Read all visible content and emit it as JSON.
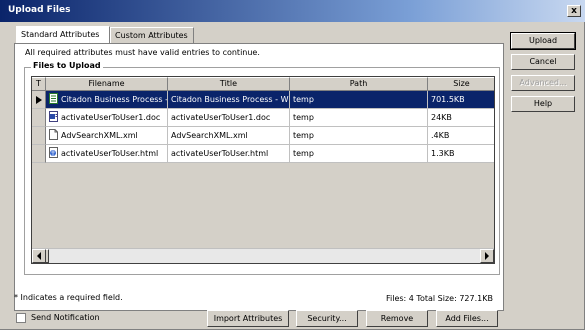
{
  "window": {
    "title": "Upload Files",
    "close_label": "x"
  },
  "tabs": [
    {
      "label": "Standard Attributes"
    },
    {
      "label": "Custom Attributes"
    }
  ],
  "required_message": "All required attributes must have valid entries to continue.",
  "files_group_label": "Files to Upload",
  "columns": [
    "T",
    "Filename",
    "Title",
    "Path",
    "Size"
  ],
  "files": [
    {
      "icon": "spreadsheet-icon",
      "filename": "Citadon Business Process - W",
      "title": "Citadon Business Process - W",
      "path": "temp",
      "size": "701.5KB",
      "selected": true
    },
    {
      "icon": "word-doc-icon",
      "filename": "activateUserToUser1.doc",
      "title": "activateUserToUser1.doc",
      "path": "temp",
      "size": "24KB",
      "selected": false
    },
    {
      "icon": "xml-file-icon",
      "filename": "AdvSearchXML.xml",
      "title": "AdvSearchXML.xml",
      "path": "temp",
      "size": ".4KB",
      "selected": false
    },
    {
      "icon": "html-file-icon",
      "filename": "activateUserToUser.html",
      "title": "activateUserToUser.html",
      "path": "temp",
      "size": "1.3KB",
      "selected": false
    }
  ],
  "side_buttons": {
    "upload": "Upload",
    "cancel": "Cancel",
    "advanced": "Advanced...",
    "help": "Help"
  },
  "footer": {
    "required_note": "* Indicates a required field.",
    "stats": "Files: 4 Total Size: 727.1KB",
    "send_notification": "Send Notification",
    "send_notification_checked": false
  },
  "bottom_buttons": {
    "import_attributes": "Import Attributes",
    "security": "Security...",
    "remove": "Remove",
    "add_files": "Add Files..."
  },
  "colors": {
    "selection": "#0a246a",
    "face": "#d4d0c8"
  }
}
